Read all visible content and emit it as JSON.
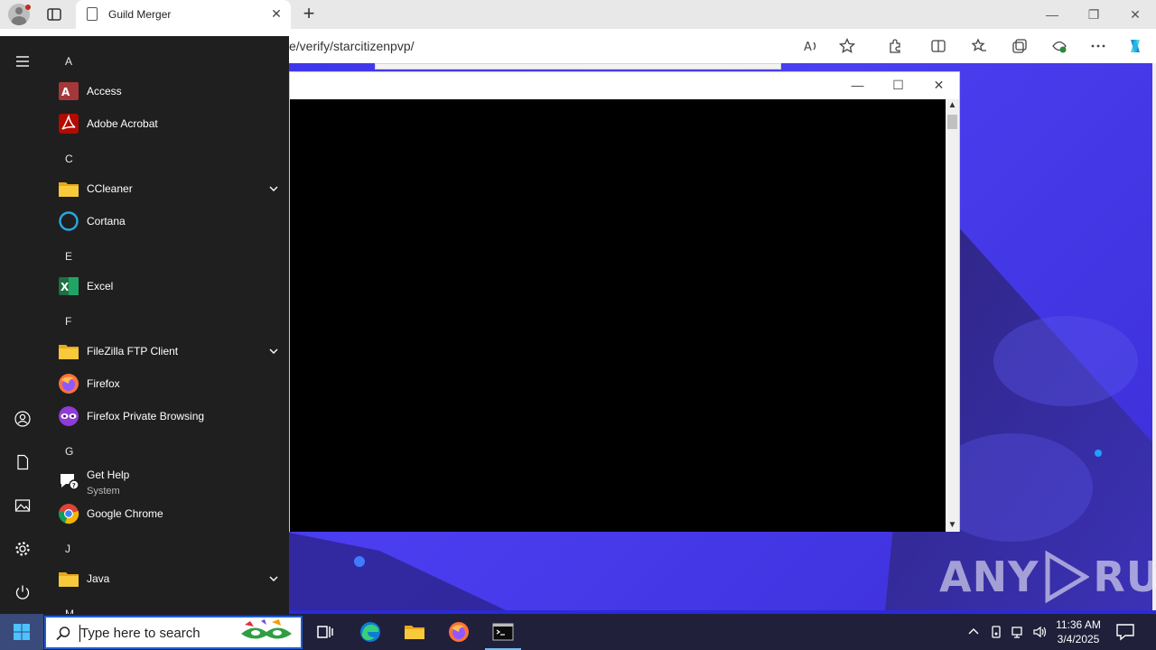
{
  "browser": {
    "tab_title": "Guild Merger",
    "tab_close": "✕",
    "new_tab": "+",
    "url": "e/verify/starcitizenpvp/",
    "window_controls": {
      "minimize": "—",
      "maximize": "❐",
      "close": "✕"
    }
  },
  "console_window": {
    "controls": {
      "minimize": "—",
      "maximize": "☐",
      "close": "✕"
    },
    "scroll_up": "▲",
    "scroll_down": "▼"
  },
  "watermark": {
    "left": "ANY",
    "right": "RUN"
  },
  "start_menu": {
    "sections": [
      {
        "letter": "A"
      },
      {
        "letter": "C"
      },
      {
        "letter": "E"
      },
      {
        "letter": "F"
      },
      {
        "letter": "G"
      },
      {
        "letter": "J"
      },
      {
        "letter": "M"
      }
    ],
    "apps": [
      {
        "name": "Access",
        "icon": "access-icon"
      },
      {
        "name": "Adobe Acrobat",
        "icon": "acrobat-icon"
      },
      {
        "name": "CCleaner",
        "icon": "folder-icon",
        "expandable": true
      },
      {
        "name": "Cortana",
        "icon": "cortana-icon"
      },
      {
        "name": "Excel",
        "icon": "excel-icon"
      },
      {
        "name": "FileZilla FTP Client",
        "icon": "folder-icon",
        "expandable": true
      },
      {
        "name": "Firefox",
        "icon": "firefox-icon"
      },
      {
        "name": "Firefox Private Browsing",
        "icon": "firefox-private-icon"
      },
      {
        "name": "Get Help",
        "subtitle": "System",
        "icon": "get-help-icon"
      },
      {
        "name": "Google Chrome",
        "icon": "chrome-icon"
      },
      {
        "name": "Java",
        "icon": "folder-icon",
        "expandable": true
      }
    ]
  },
  "taskbar": {
    "search_placeholder": "Type here to search",
    "clock_time": "11:36 AM",
    "clock_date": "3/4/2025"
  },
  "colors": {
    "accent_blue": "#1e5fd6",
    "start_menu_bg": "#1f1f1f",
    "page_bg": "#3b33e6"
  }
}
